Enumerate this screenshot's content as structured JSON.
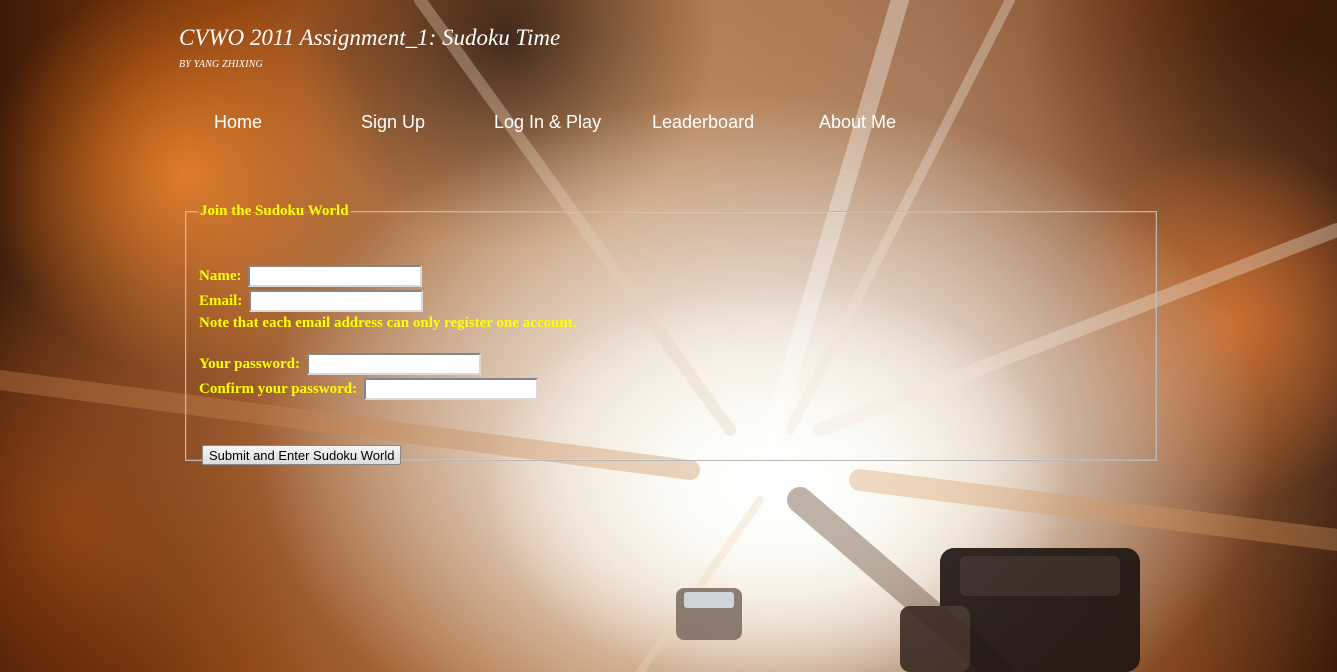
{
  "header": {
    "title": "CVWO 2011 Assignment_1: Sudoku Time",
    "byline": "BY YANG ZHIXING"
  },
  "nav": {
    "items": [
      {
        "label": "Home"
      },
      {
        "label": "Sign Up"
      },
      {
        "label": "Log In & Play"
      },
      {
        "label": "Leaderboard"
      },
      {
        "label": "About Me"
      }
    ]
  },
  "form": {
    "legend": "Join the Sudoku World",
    "name_label": "Name:",
    "name_value": "",
    "email_label": "Email:",
    "email_value": "",
    "email_note": "Note that each email address can only register one account.",
    "password_label": "Your password:",
    "password_value": "",
    "confirm_label": "Confirm your password:",
    "confirm_value": "",
    "submit_label": "Submit and Enter Sudoku World"
  },
  "colors": {
    "label_text": "#ffff00",
    "header_text": "#ffffff"
  }
}
